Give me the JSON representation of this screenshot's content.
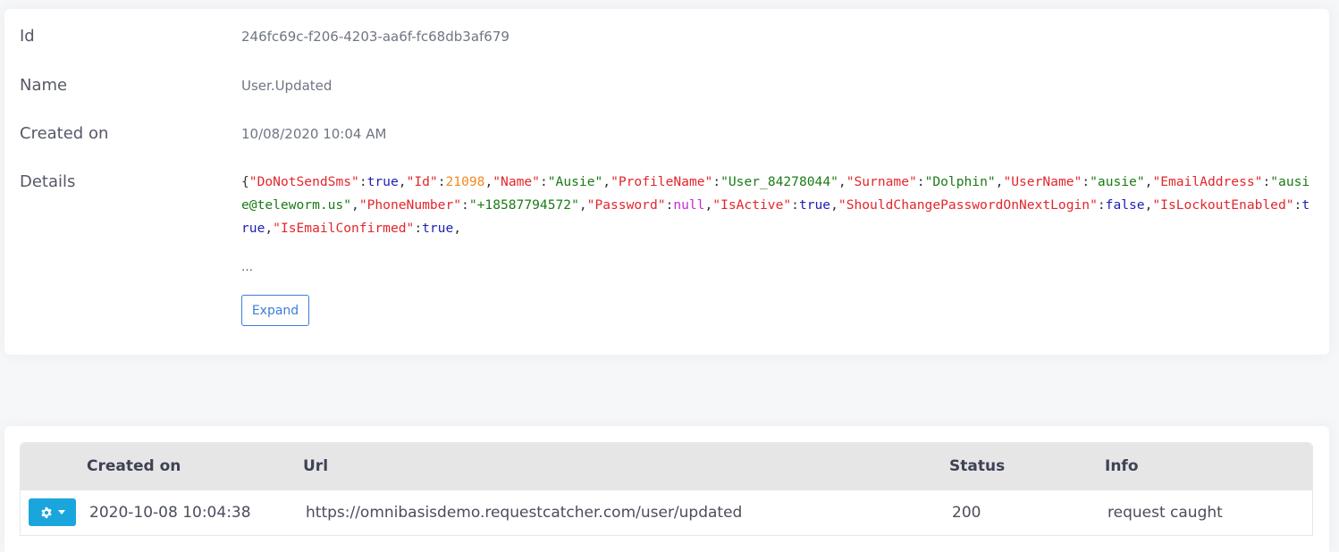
{
  "details": {
    "id_label": "Id",
    "id_value": "246fc69c-f206-4203-aa6f-fc68db3af679",
    "name_label": "Name",
    "name_value": "User.Updated",
    "created_label": "Created on",
    "created_value": "10/08/2020 10:04 AM",
    "details_label": "Details",
    "json_tokens": [
      {
        "t": "p",
        "v": "{"
      },
      {
        "t": "k",
        "v": "\"DoNotSendSms\""
      },
      {
        "t": "p",
        "v": ":"
      },
      {
        "t": "b",
        "v": "true"
      },
      {
        "t": "p",
        "v": ","
      },
      {
        "t": "k",
        "v": "\"Id\""
      },
      {
        "t": "p",
        "v": ":"
      },
      {
        "t": "n",
        "v": "21098"
      },
      {
        "t": "p",
        "v": ","
      },
      {
        "t": "k",
        "v": "\"Name\""
      },
      {
        "t": "p",
        "v": ":"
      },
      {
        "t": "s",
        "v": "\"Ausie\""
      },
      {
        "t": "p",
        "v": ","
      },
      {
        "t": "k",
        "v": "\"ProfileName\""
      },
      {
        "t": "p",
        "v": ":"
      },
      {
        "t": "s",
        "v": "\"User_84278044\""
      },
      {
        "t": "p",
        "v": ","
      },
      {
        "t": "k",
        "v": "\"Surname\""
      },
      {
        "t": "p",
        "v": ":"
      },
      {
        "t": "s",
        "v": "\"Dolphin\""
      },
      {
        "t": "p",
        "v": ","
      },
      {
        "t": "k",
        "v": "\"UserName\""
      },
      {
        "t": "p",
        "v": ":"
      },
      {
        "t": "s",
        "v": "\"ausie\""
      },
      {
        "t": "p",
        "v": ","
      },
      {
        "t": "k",
        "v": "\"EmailAddress\""
      },
      {
        "t": "p",
        "v": ":"
      },
      {
        "t": "s",
        "v": "\"ausie@teleworm.us\""
      },
      {
        "t": "p",
        "v": ","
      },
      {
        "t": "k",
        "v": "\"PhoneNumber\""
      },
      {
        "t": "p",
        "v": ":"
      },
      {
        "t": "s",
        "v": "\"+18587794572\""
      },
      {
        "t": "p",
        "v": ","
      },
      {
        "t": "k",
        "v": "\"Password\""
      },
      {
        "t": "p",
        "v": ":"
      },
      {
        "t": "u",
        "v": "null"
      },
      {
        "t": "p",
        "v": ","
      },
      {
        "t": "k",
        "v": "\"IsActive\""
      },
      {
        "t": "p",
        "v": ":"
      },
      {
        "t": "b",
        "v": "true"
      },
      {
        "t": "p",
        "v": ","
      },
      {
        "t": "k",
        "v": "\"ShouldChangePasswordOnNextLogin\""
      },
      {
        "t": "p",
        "v": ":"
      },
      {
        "t": "b",
        "v": "false"
      },
      {
        "t": "p",
        "v": ","
      },
      {
        "t": "k",
        "v": "\"IsLockoutEnabled\""
      },
      {
        "t": "p",
        "v": ":"
      },
      {
        "t": "b",
        "v": "true"
      },
      {
        "t": "p",
        "v": ","
      },
      {
        "t": "k",
        "v": "\"IsEmailConfirmed\""
      },
      {
        "t": "p",
        "v": ":"
      },
      {
        "t": "b",
        "v": "true"
      },
      {
        "t": "p",
        "v": ","
      }
    ],
    "ellipsis": "…",
    "expand_label": "Expand"
  },
  "webhook_table": {
    "headers": {
      "created_on": "Created on",
      "url": "Url",
      "status": "Status",
      "info": "Info"
    },
    "rows": [
      {
        "created_on": "2020-10-08 10:04:38",
        "url": "https://omnibasisdemo.requestcatcher.com/user/updated",
        "status": "200",
        "info": "request caught",
        "action_icon": "gear-icon"
      }
    ]
  },
  "colors": {
    "json_key": "#e3262c",
    "json_string": "#1b7b16",
    "json_bool": "#1d1fb3",
    "json_number": "#f08a1d",
    "json_null": "#c62ad6",
    "primary": "#3b7dd8",
    "action_button": "#1aa6dc"
  }
}
